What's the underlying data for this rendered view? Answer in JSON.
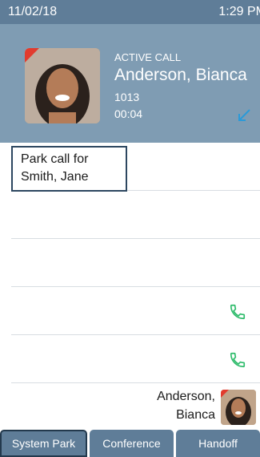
{
  "status_bar": {
    "date": "11/02/18",
    "time": "1:29 PM"
  },
  "active_call": {
    "state": "ACTIVE CALL",
    "name": "Anderson, Bianca",
    "extension": "1013",
    "duration": "00:04",
    "direction_icon": "incoming-call-arrow-icon"
  },
  "park_prompt": {
    "line1": "Park call for",
    "line2": "Smith, Jane"
  },
  "line_keys": [
    {
      "icon": ""
    },
    {
      "icon": ""
    },
    {
      "icon": ""
    },
    {
      "icon": "phone-icon"
    },
    {
      "icon": "phone-icon"
    },
    {
      "contact": {
        "first_line": "Anderson,",
        "second_line": "Bianca"
      }
    }
  ],
  "softkeys": [
    {
      "label": "System Park",
      "selected": true
    },
    {
      "label": "Conference",
      "selected": false
    },
    {
      "label": "Handoff",
      "selected": false
    }
  ],
  "colors": {
    "status_bar": "#5f7d98",
    "header": "#7f9cb3",
    "phone_icon": "#2dbb6a",
    "direction_arrow": "#2b9ad8",
    "selection_border": "#2d4760"
  }
}
